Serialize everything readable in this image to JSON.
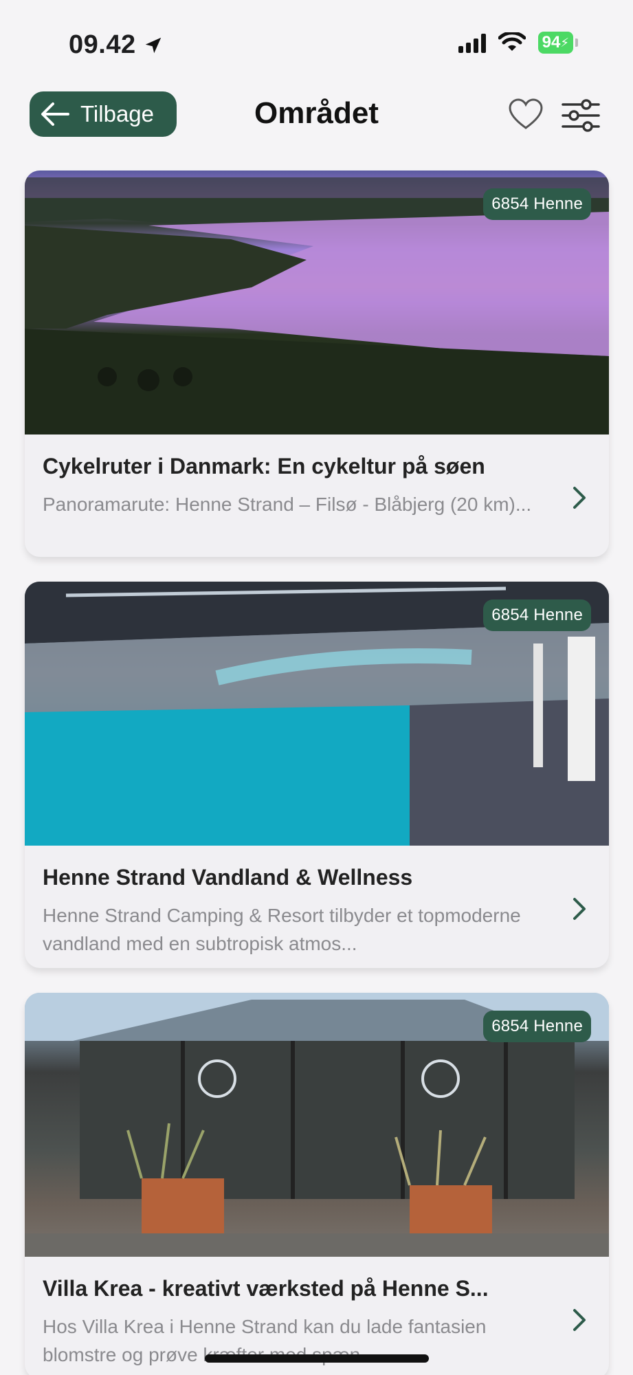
{
  "status": {
    "time": "09.42",
    "battery": "94"
  },
  "nav": {
    "back_label": "Tilbage",
    "title": "Området"
  },
  "cards": [
    {
      "badge": "6854 Henne",
      "title": "Cykelruter i Danmark: En cykeltur på søen",
      "description": "Panoramarute: Henne Strand – Filsø - Blåbjerg (20 km)..."
    },
    {
      "badge": "6854 Henne",
      "title": "Henne Strand Vandland & Wellness",
      "description": "Henne Strand Camping & Resort tilbyder et topmoderne vandland med en subtropisk atmos..."
    },
    {
      "badge": "6854 Henne",
      "title": "Villa Krea - kreativt værksted på Henne S...",
      "description": "Hos Villa Krea i Henne Strand kan du lade fantasien blomstre og prøve kræfter med spæn..."
    }
  ],
  "colors": {
    "accent": "#2d5b4a",
    "background": "#f5f4f6",
    "battery": "#4cd964"
  }
}
